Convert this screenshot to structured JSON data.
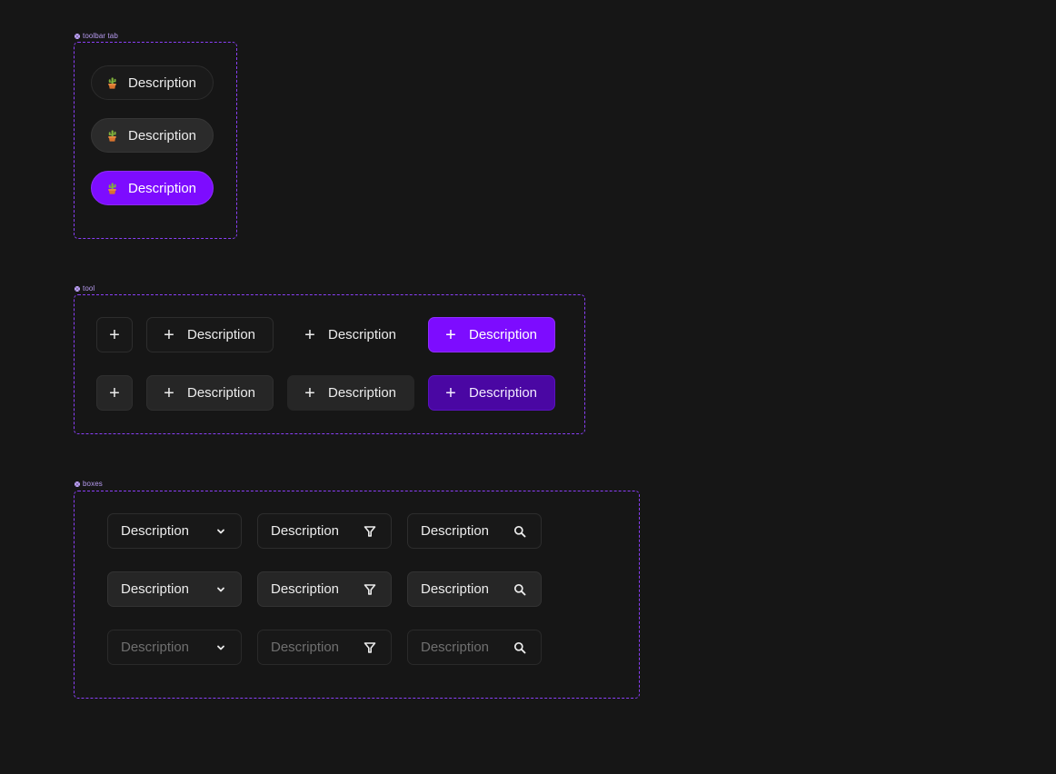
{
  "sections": {
    "toolbar_tab": {
      "label": "toolbar tab"
    },
    "tool": {
      "label": "tool"
    },
    "boxes": {
      "label": "boxes"
    }
  },
  "toolbar_tabs": [
    {
      "label": "Description",
      "state": "default"
    },
    {
      "label": "Description",
      "state": "hover"
    },
    {
      "label": "Description",
      "state": "active"
    }
  ],
  "tool_rows": [
    {
      "state": "default",
      "buttons": [
        {
          "icon": "plus-icon",
          "label": ""
        },
        {
          "icon": "plus-icon",
          "label": "Description"
        },
        {
          "icon": "plus-icon",
          "label": "Description"
        },
        {
          "icon": "plus-icon",
          "label": "Description"
        }
      ]
    },
    {
      "state": "hover",
      "buttons": [
        {
          "icon": "plus-icon",
          "label": ""
        },
        {
          "icon": "plus-icon",
          "label": "Description"
        },
        {
          "icon": "plus-icon",
          "label": "Description"
        },
        {
          "icon": "plus-icon",
          "label": "Description"
        }
      ]
    }
  ],
  "box_rows": [
    {
      "state": "default",
      "boxes": [
        {
          "label": "Description",
          "icon": "chevron-down-icon"
        },
        {
          "label": "Description",
          "icon": "filter-icon"
        },
        {
          "label": "Description",
          "icon": "search-icon"
        }
      ]
    },
    {
      "state": "hover",
      "boxes": [
        {
          "label": "Description",
          "icon": "chevron-down-icon"
        },
        {
          "label": "Description",
          "icon": "filter-icon"
        },
        {
          "label": "Description",
          "icon": "search-icon"
        }
      ]
    },
    {
      "state": "placeholder",
      "boxes": [
        {
          "label": "Description",
          "icon": "chevron-down-icon"
        },
        {
          "label": "Description",
          "icon": "filter-icon"
        },
        {
          "label": "Description",
          "icon": "search-icon"
        }
      ]
    }
  ],
  "colors": {
    "background": "#161616",
    "accent": "#7d0cff",
    "accent_dark": "#4a07a3",
    "frame_dash": "#8a3ff7"
  }
}
